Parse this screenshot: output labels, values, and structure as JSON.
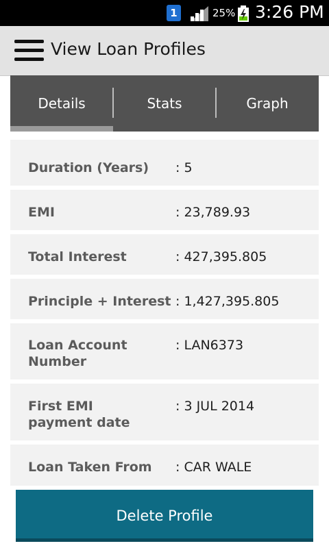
{
  "status_bar": {
    "notification_badge": "1",
    "battery_percent": "25%",
    "time": "3:26 PM",
    "icons": [
      "notification-icon",
      "signal-icon",
      "battery-charging-icon"
    ]
  },
  "action_bar": {
    "title": "View Loan Profiles",
    "menu_icon": "hamburger-menu-icon"
  },
  "tabs": [
    {
      "label": "Details",
      "selected": true
    },
    {
      "label": "Stats",
      "selected": false
    },
    {
      "label": "Graph",
      "selected": false
    }
  ],
  "details": [
    {
      "label": "Duration (Years)",
      "value": ": 5"
    },
    {
      "label": "EMI",
      "value": ": 23,789.93"
    },
    {
      "label": "Total Interest",
      "value": ": 427,395.805"
    },
    {
      "label": "Principle + Interest",
      "value": ": 1,427,395.805"
    },
    {
      "label": "Loan Account Number",
      "value": ": LAN6373"
    },
    {
      "label": "First EMI payment date",
      "value": ": 3 JUL 2014"
    },
    {
      "label": "Loan Taken From",
      "value": ": CAR WALE"
    }
  ],
  "delete_button": {
    "label": "Delete Profile"
  },
  "colors": {
    "action_bar_bg": "#e3e3e3",
    "tab_bar_bg": "#525252",
    "row_bg": "#f2f2f2",
    "button_bg": "#0e6b84"
  }
}
